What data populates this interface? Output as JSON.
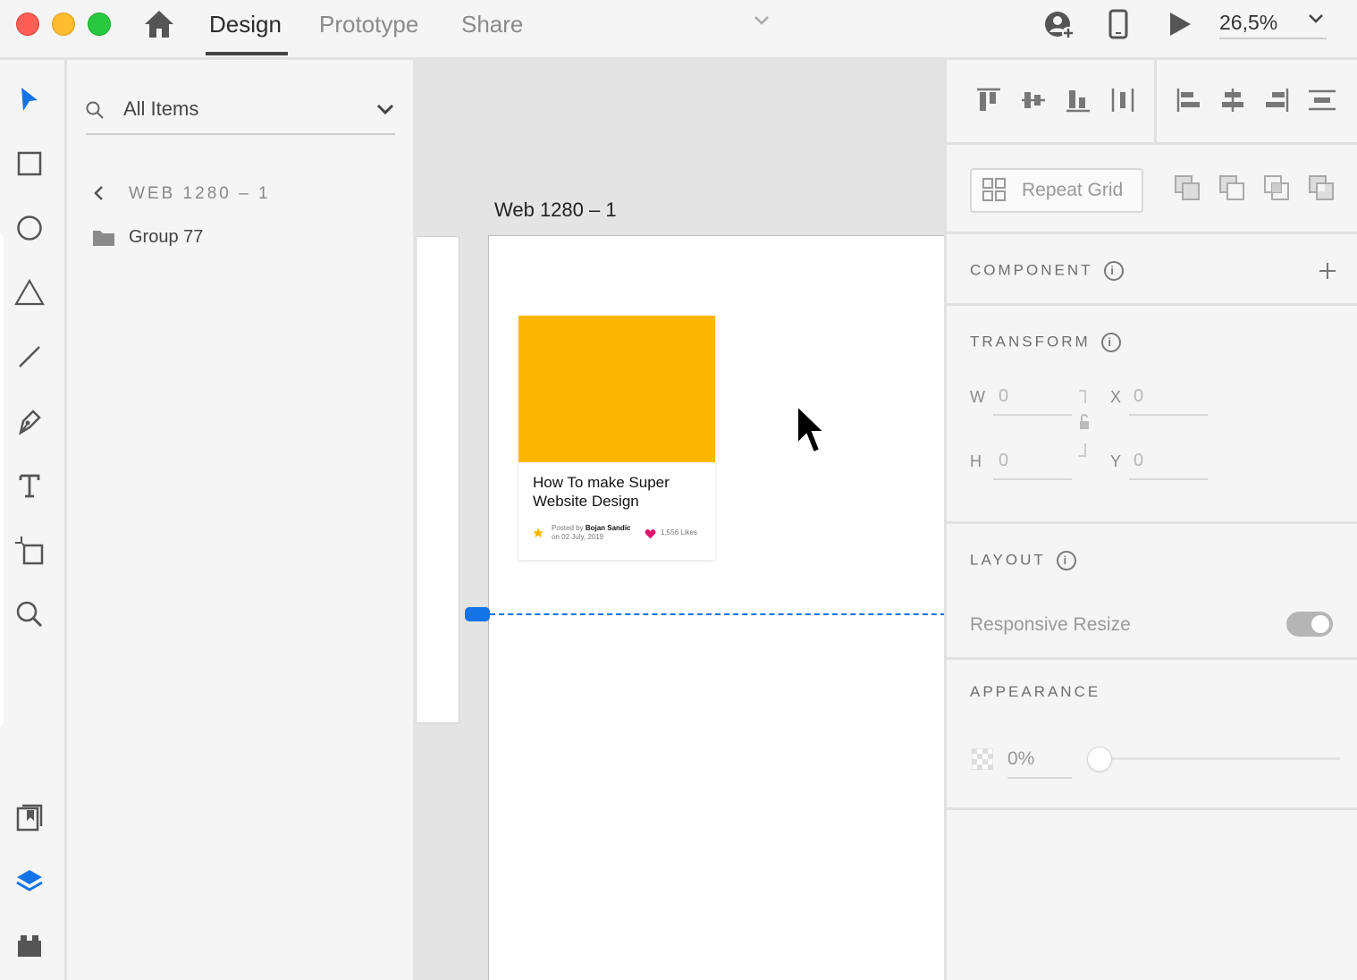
{
  "titlebar": {
    "tabs": [
      {
        "label": "Design",
        "active": true
      },
      {
        "label": "Prototype",
        "active": false
      },
      {
        "label": "Share",
        "active": false
      }
    ],
    "zoom": "26,5%"
  },
  "layers": {
    "search_placeholder": "All Items",
    "breadcrumb": "WEB 1280 – 1",
    "items": [
      {
        "label": "Group 77"
      }
    ]
  },
  "canvas": {
    "artboard_label": "Web 1280 – 1",
    "card": {
      "title": "How To make Super Website Design",
      "posted_by_prefix": "Posted by",
      "author": "Bojan Sandic",
      "date": "on 02 July, 2019",
      "likes": "1,556 Likes",
      "image_color": "#FDB700"
    }
  },
  "props": {
    "repeat_grid_label": "Repeat Grid",
    "component_title": "COMPONENT",
    "transform_title": "TRANSFORM",
    "w_label": "W",
    "w_value": "0",
    "h_label": "H",
    "h_value": "0",
    "x_label": "X",
    "x_value": "0",
    "y_label": "Y",
    "y_value": "0",
    "layout_title": "LAYOUT",
    "responsive_resize_label": "Responsive Resize",
    "responsive_resize_on": true,
    "appearance_title": "APPEARANCE",
    "opacity_value": "0%"
  },
  "colors": {
    "accent": "#1473E6",
    "close": "#FF5F57",
    "minimize": "#FEBC2E",
    "zoom": "#28C840"
  }
}
